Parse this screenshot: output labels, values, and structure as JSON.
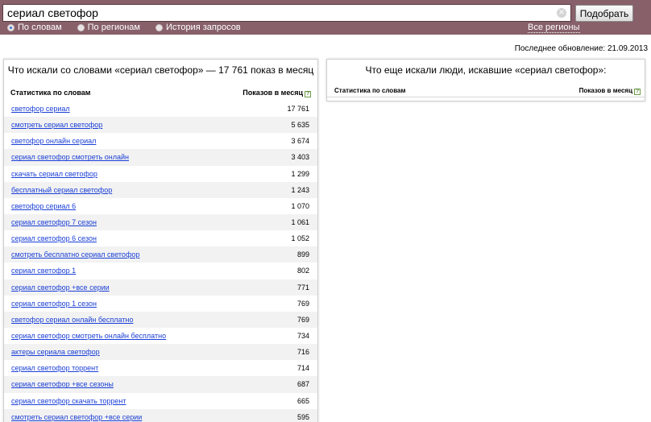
{
  "search": {
    "query": "сериал светофор",
    "submit_label": "Подобрать",
    "radio_options": [
      {
        "label": "По словам",
        "checked": true
      },
      {
        "label": "По регионам",
        "checked": false
      },
      {
        "label": "История запросов",
        "checked": false
      }
    ],
    "regions_link": "Все регионы"
  },
  "last_updated": "Последнее обновление: 21.09.2013",
  "left_panel": {
    "title": "Что искали со словами «сериал светофор» — 17 761 показ в месяц",
    "col_stats": "Статистика по словам",
    "col_shows": "Показов в месяц",
    "rows": [
      {
        "phrase": "светофор сериал",
        "count": "17 761"
      },
      {
        "phrase": "смотреть сериал светофор",
        "count": "5 635"
      },
      {
        "phrase": "светофор онлайн сериал",
        "count": "3 674"
      },
      {
        "phrase": "сериал светофор смотреть онлайн",
        "count": "3 403"
      },
      {
        "phrase": "скачать сериал светофор",
        "count": "1 299"
      },
      {
        "phrase": "бесплатный сериал светофор",
        "count": "1 243"
      },
      {
        "phrase": "светофор сериал 6",
        "count": "1 070"
      },
      {
        "phrase": "сериал светофор 7 сезон",
        "count": "1 061"
      },
      {
        "phrase": "сериал светофор 6 сезон",
        "count": "1 052"
      },
      {
        "phrase": "смотреть бесплатно сериал светофор",
        "count": "899"
      },
      {
        "phrase": "сериал светофор 1",
        "count": "802"
      },
      {
        "phrase": "сериал светофор +все серии",
        "count": "771"
      },
      {
        "phrase": "сериал светофор 1 сезон",
        "count": "769"
      },
      {
        "phrase": "светофор сериал онлайн бесплатно",
        "count": "769"
      },
      {
        "phrase": "сериал светофор смотреть онлайн бесплатно",
        "count": "734"
      },
      {
        "phrase": "актеры сериала светофор",
        "count": "716"
      },
      {
        "phrase": "сериал светофор торрент",
        "count": "714"
      },
      {
        "phrase": "сериал светофор +все сезоны",
        "count": "687"
      },
      {
        "phrase": "сериал светофор скачать торрент",
        "count": "665"
      },
      {
        "phrase": "смотреть сериал светофор +все серии",
        "count": "595"
      }
    ]
  },
  "right_panel": {
    "title": "Что еще искали люди, искавшие «сериал светофор»:",
    "col_stats": "Статистика по словам",
    "col_shows": "Показов в месяц"
  },
  "icons": {
    "clear": "close-icon",
    "help": "question-icon"
  },
  "colors": {
    "topbar": "#87606a",
    "link": "#1a3fd6",
    "stripe": "#f2f2f2"
  }
}
